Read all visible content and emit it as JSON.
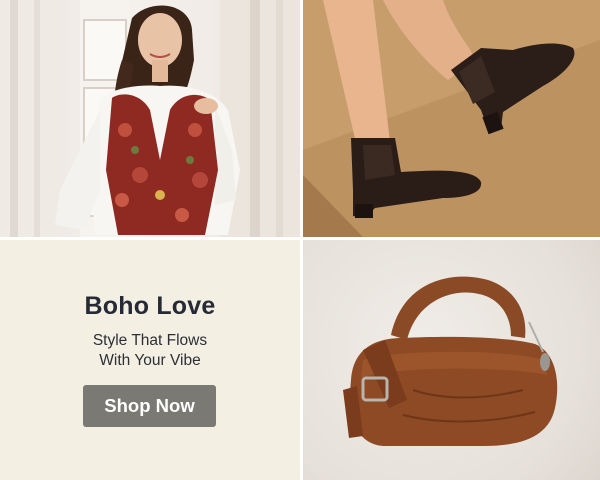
{
  "promo": {
    "title": "Boho Love",
    "subtitle_line1": "Style That Flows",
    "subtitle_line2": "With Your Vibe",
    "cta_label": "Shop Now"
  },
  "colors": {
    "promo_background": "#f3efe3",
    "title_text": "#252a35",
    "cta_background": "#7a7973",
    "cta_text": "#ffffff"
  },
  "images": [
    {
      "name": "model-floral-vest-photo",
      "depicts": "woman-in-floral-vest"
    },
    {
      "name": "ankle-boots-photo",
      "depicts": "black-chelsea-ankle-boots"
    },
    {
      "name": "leather-handbag-photo",
      "depicts": "brown-leather-hobo-bag"
    }
  ]
}
